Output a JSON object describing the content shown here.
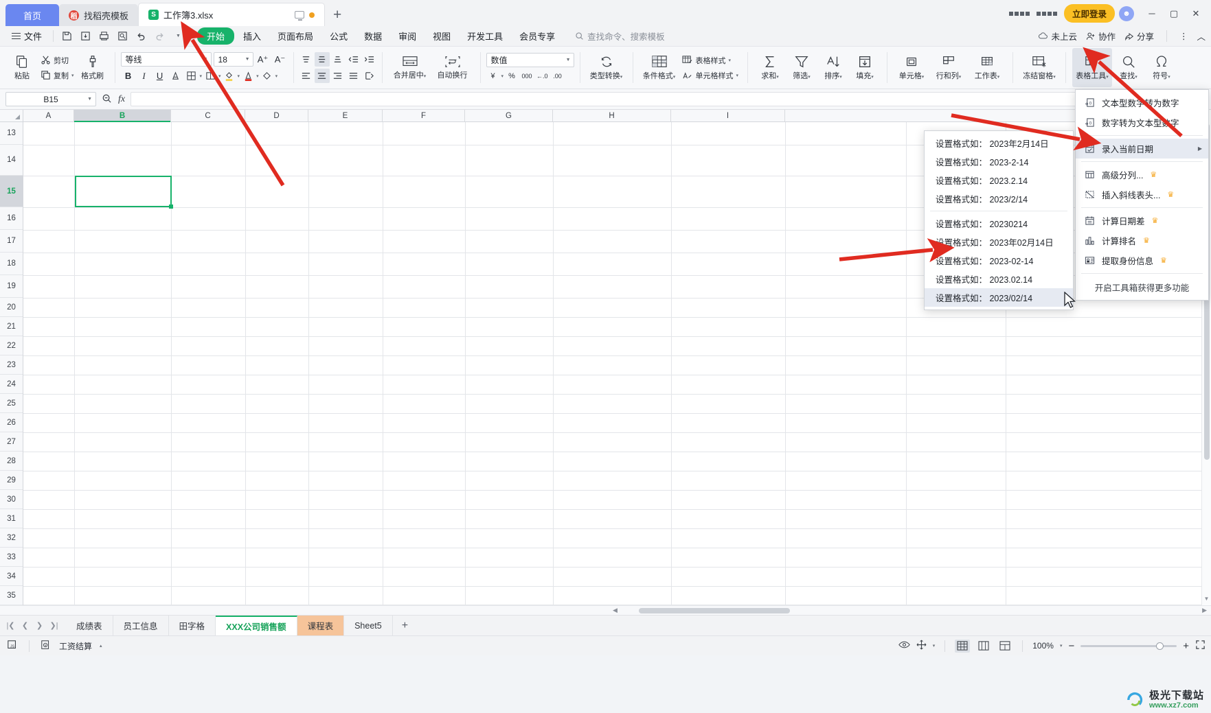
{
  "titlebar": {
    "home_tab": "首页",
    "template_tab": "找稻壳模板",
    "doc_tab": "工作簿3.xlsx",
    "new_tab": "+",
    "login_button": "立即登录",
    "minimize": "─",
    "maximize": "▢",
    "close": "✕"
  },
  "menubar": {
    "file": "文件",
    "items": [
      "开始",
      "插入",
      "页面布局",
      "公式",
      "数据",
      "审阅",
      "视图",
      "开发工具",
      "会员专享"
    ],
    "active_item": "开始",
    "search_placeholder": "查找命令、搜索模板",
    "cloud_status": "未上云",
    "collaborate": "协作",
    "share": "分享"
  },
  "ribbon": {
    "paste": "粘贴",
    "cut": "剪切",
    "copy": "复制",
    "format_painter": "格式刷",
    "font_name": "等线",
    "font_size": "18",
    "merge_center": "合并居中",
    "wrap_text": "自动换行",
    "number_format": "数值",
    "type_convert": "类型转换",
    "conditional_format": "条件格式",
    "table_style": "表格样式",
    "cell_style": "单元格样式",
    "sum": "求和",
    "filter": "筛选",
    "sort": "排序",
    "fill": "填充",
    "cell": "单元格",
    "rows_cols": "行和列",
    "worksheet": "工作表",
    "freeze_panes": "冻结窗格",
    "table_tools": "表格工具",
    "find": "查找",
    "symbol": "符号",
    "bold": "B",
    "italic": "I",
    "underline": "U"
  },
  "formulabar": {
    "name_box": "B15",
    "formula_value": ""
  },
  "grid": {
    "columns": [
      "A",
      "B",
      "C",
      "D",
      "E",
      "F",
      "G",
      "H",
      "I"
    ],
    "rows": [
      "13",
      "14",
      "15",
      "16",
      "17",
      "18",
      "19",
      "20",
      "21",
      "22",
      "23",
      "24",
      "25",
      "26",
      "27",
      "28",
      "29",
      "30",
      "31",
      "32",
      "33",
      "34",
      "35"
    ],
    "selected_cell": "B15",
    "selected_column": "B",
    "selected_row": "15"
  },
  "table_tools_menu": {
    "items": [
      {
        "label": "文本型数字转为数字",
        "icon": "text-to-number-icon",
        "crown": false,
        "submenu": false,
        "highlighted": false
      },
      {
        "label": "数字转为文本型数字",
        "icon": "number-to-text-icon",
        "crown": false,
        "submenu": false,
        "highlighted": false
      },
      {
        "label": "录入当前日期",
        "icon": "insert-date-icon",
        "crown": false,
        "submenu": true,
        "highlighted": true
      },
      {
        "label": "高级分列...",
        "icon": "split-columns-icon",
        "crown": true,
        "submenu": false,
        "highlighted": false
      },
      {
        "label": "插入斜线表头...",
        "icon": "diagonal-header-icon",
        "crown": true,
        "submenu": false,
        "highlighted": false
      },
      {
        "label": "计算日期差",
        "icon": "date-diff-icon",
        "crown": true,
        "submenu": false,
        "highlighted": false
      },
      {
        "label": "计算排名",
        "icon": "rank-icon",
        "crown": true,
        "submenu": false,
        "highlighted": false
      },
      {
        "label": "提取身份信息",
        "icon": "id-extract-icon",
        "crown": true,
        "submenu": false,
        "highlighted": false
      }
    ],
    "separators_after": [
      1,
      4
    ],
    "footer": "开启工具箱获得更多功能"
  },
  "date_submenu": {
    "items": [
      {
        "label": "设置格式如： 2023年2月14日",
        "highlighted": false
      },
      {
        "label": "设置格式如： 2023-2-14",
        "highlighted": false
      },
      {
        "label": "设置格式如： 2023.2.14",
        "highlighted": false
      },
      {
        "label": "设置格式如： 2023/2/14",
        "highlighted": false
      },
      {
        "label": "设置格式如： 20230214",
        "highlighted": false
      },
      {
        "label": "设置格式如： 2023年02月14日",
        "highlighted": false
      },
      {
        "label": "设置格式如： 2023-02-14",
        "highlighted": false
      },
      {
        "label": "设置格式如： 2023.02.14",
        "highlighted": false
      },
      {
        "label": "设置格式如： 2023/02/14",
        "highlighted": true
      }
    ],
    "separator_after": 3
  },
  "sheettabs": {
    "tabs": [
      "成绩表",
      "员工信息",
      "田字格",
      "XXX公司销售额",
      "课程表",
      "Sheet5"
    ],
    "active": "XXX公司销售额",
    "orange_tab": "课程表",
    "add": "+"
  },
  "statusbar": {
    "salary_calc": "工资结算",
    "zoom": "100%",
    "zoom_minus": "−",
    "zoom_plus": "+"
  },
  "watermark": {
    "top": "极光下载站",
    "url": "www.xz7.com"
  },
  "colors": {
    "accent_green": "#17b26a",
    "home_blue": "#6a87f0",
    "login_amber": "#fbbf24",
    "annotation_red": "#e02b20",
    "orange_tab": "#f6c49a",
    "highlight": "#e6eaf2"
  }
}
